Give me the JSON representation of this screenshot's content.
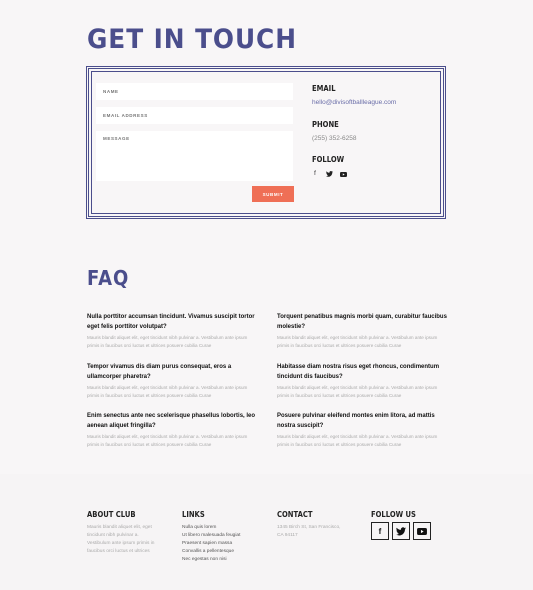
{
  "page": {
    "title": "GET IN TOUCH"
  },
  "form": {
    "name_placeholder": "NAME",
    "email_placeholder": "EMAIL ADDRESS",
    "message_placeholder": "MESSAGE",
    "submit_label": "SUBMIT"
  },
  "contact_info": {
    "email_heading": "EMAIL",
    "email_value": "hello@divisoftballleague.com",
    "phone_heading": "PHONE",
    "phone_value": "(255) 352-6258",
    "follow_heading": "FOLLOW",
    "social_icons": [
      "facebook-icon",
      "twitter-icon",
      "youtube-icon"
    ]
  },
  "faq": {
    "title": "FAQ",
    "items": [
      {
        "q": "Nulla porttitor accumsan tincidunt. Vivamus suscipit tortor eget felis porttitor volutpat?",
        "a": "Mauris blandit aliquet elit, eget tincidunt nibh pulvinar a. Vestibulum ante ipsum primis in faucibus orci luctus et ultrices posuere cubilia Curae"
      },
      {
        "q": "Torquent penatibus magnis morbi quam, curabitur faucibus molestie?",
        "a": "Mauris blandit aliquet elit, eget tincidunt nibh pulvinar a. Vestibulum ante ipsum primis in faucibus orci luctus et ultrices posuere cubilia Curae"
      },
      {
        "q": "Tempor vivamus dis diam purus consequat, eros a ullamcorper pharetra?",
        "a": "Mauris blandit aliquet elit, eget tincidunt nibh pulvinar a. Vestibulum ante ipsum primis in faucibus orci luctus et ultrices posuere cubilia Curae"
      },
      {
        "q": "Habitasse diam nostra risus eget rhoncus, condimentum tincidunt dis faucibus?",
        "a": "Mauris blandit aliquet elit, eget tincidunt nibh pulvinar a. Vestibulum ante ipsum primis in faucibus orci luctus et ultrices posuere cubilia Curae"
      },
      {
        "q": "Enim senectus ante nec scelerisque phasellus lobortis, leo aenean aliquet fringilla?",
        "a": "Mauris blandit aliquet elit, eget tincidunt nibh pulvinar a. Vestibulum ante ipsum primis in faucibus orci luctus et ultrices posuere cubilia Curae"
      },
      {
        "q": "Posuere pulvinar eleifend montes enim litora, ad mattis nostra suscipit?",
        "a": "Mauris blandit aliquet elit, eget tincidunt nibh pulvinar a. Vestibulum ante ipsum primis in faucibus orci luctus et ultrices posuere cubilia Curae"
      }
    ]
  },
  "footer": {
    "about_heading": "ABOUT CLUB",
    "about_text": "Mauris blandit aliquet elit, eget tincidunt nibh pulvinar a. Vestibulum ante ipsum primis in faucibus orci luctus et ultrices",
    "links_heading": "LINKS",
    "links": [
      "Nulla quis lorem",
      "Ut libero malesuada feugiat",
      "Praesent sapien massa",
      "Convallis a pellentesque",
      "Nec egestas non nisi"
    ],
    "contact_heading": "CONTACT",
    "contact_text": "1345 Birch St, San Francisco, CA 94117",
    "follow_heading": "FOLLOW US",
    "social_icons": [
      "facebook-icon",
      "twitter-icon",
      "youtube-icon"
    ]
  },
  "colors": {
    "accent": "#4b4e8c",
    "button": "#ef6f56",
    "background": "#f8f6f7"
  }
}
